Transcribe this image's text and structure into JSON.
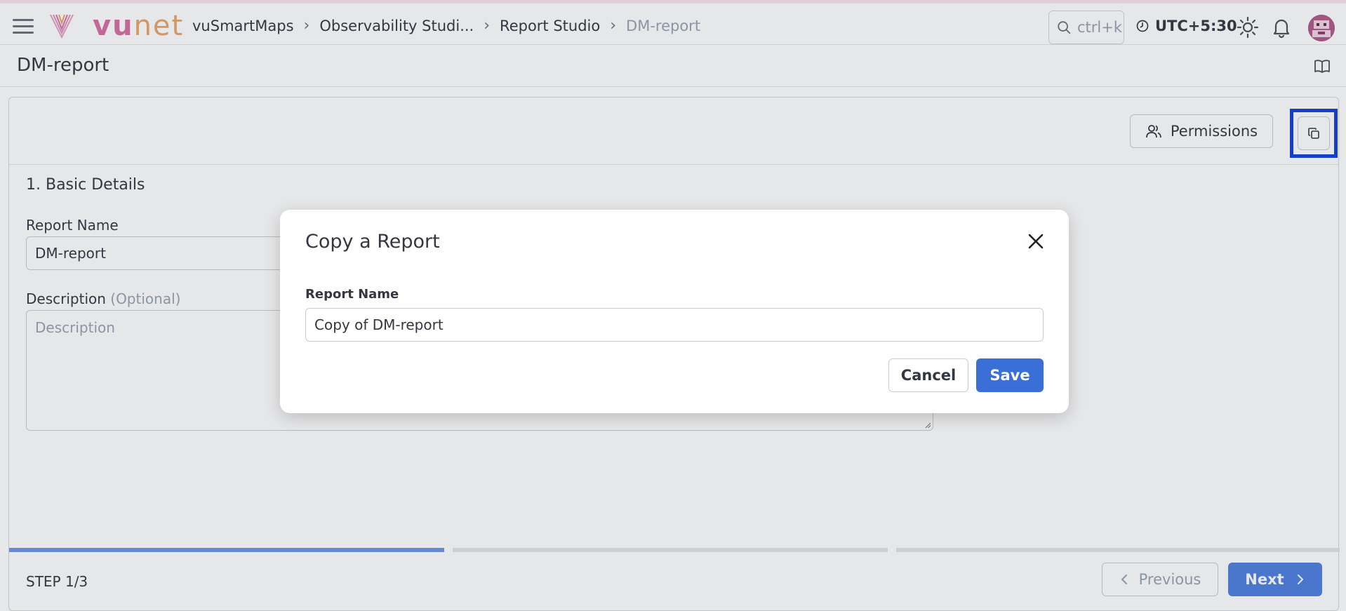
{
  "nav": {
    "logo": {
      "vu": "vu",
      "net": "net"
    },
    "breadcrumb": [
      "vuSmartMaps",
      "Observability Studi...",
      "Report Studio",
      "DM-report"
    ],
    "search_placeholder": "ctrl+k",
    "timezone": "UTC+5:30",
    "icons": [
      "menu-icon",
      "search-icon",
      "clock-icon",
      "sun-icon",
      "bell-icon",
      "avatar"
    ]
  },
  "page": {
    "title": "DM-report",
    "docs_icon": "book-icon"
  },
  "toolbar": {
    "permissions_label": "Permissions",
    "copy_icon": "copy-icon"
  },
  "form": {
    "section_title": "1. Basic Details",
    "report_name_label": "Report Name",
    "report_name_value": "DM-report",
    "description_label": "Description",
    "description_optional": "(Optional)",
    "description_placeholder": "Description"
  },
  "wizard": {
    "step_label": "STEP 1/3",
    "current_step": 1,
    "total_steps": 3,
    "previous_label": "Previous",
    "next_label": "Next"
  },
  "modal": {
    "title": "Copy a Report",
    "field_label": "Report Name",
    "field_value": "Copy of DM-report",
    "cancel_label": "Cancel",
    "save_label": "Save"
  },
  "colors": {
    "primary": "#3a6fd8",
    "highlight_border": "#1240d6",
    "logo_vu": "#d76fa6",
    "logo_net": "#e9a46c"
  }
}
